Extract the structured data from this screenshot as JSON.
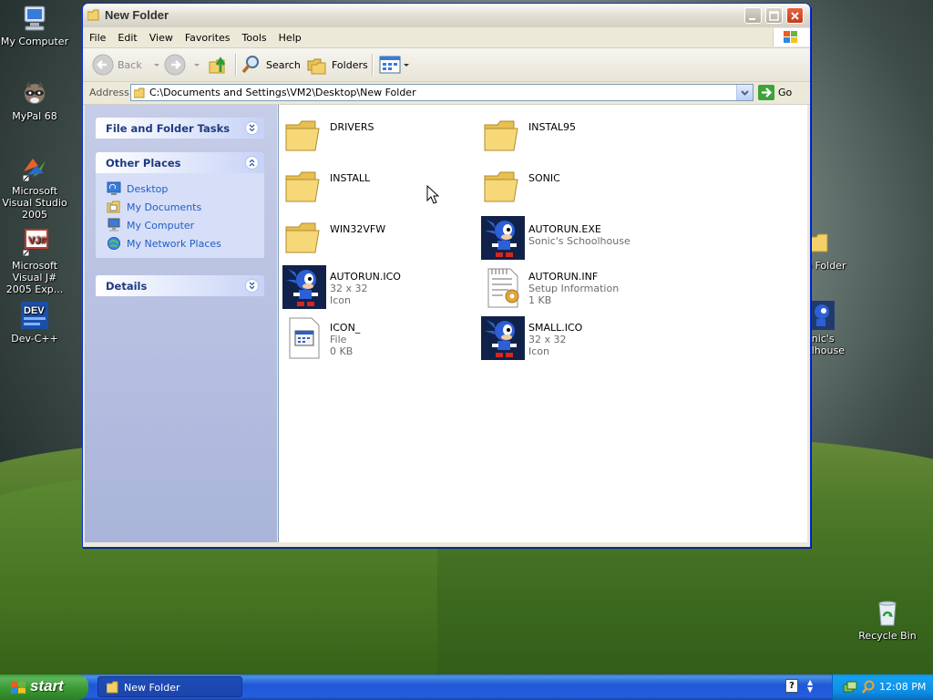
{
  "desktop": {
    "icons": [
      {
        "label": "My Computer"
      },
      {
        "label": "MyPal 68"
      },
      {
        "label": "Microsoft Visual Studio 2005"
      },
      {
        "label": "Microsoft Visual J# 2005 Exp..."
      },
      {
        "label": "Dev-C++"
      },
      {
        "label": "p Folder"
      },
      {
        "label": "onic's olhouse"
      },
      {
        "label": "Recycle Bin"
      }
    ]
  },
  "window": {
    "title": "New Folder",
    "menu": [
      "File",
      "Edit",
      "View",
      "Favorites",
      "Tools",
      "Help"
    ],
    "toolbar": {
      "back_label": "Back",
      "search_label": "Search",
      "folders_label": "Folders"
    },
    "address": {
      "label": "Address",
      "path": "C:\\Documents and Settings\\VM2\\Desktop\\New Folder",
      "go_label": "Go"
    },
    "taskpane": {
      "file_tasks": "File and Folder Tasks",
      "other_places": "Other Places",
      "places": [
        "Desktop",
        "My Documents",
        "My Computer",
        "My Network Places"
      ],
      "details": "Details"
    },
    "files": [
      {
        "name": "DRIVERS",
        "line2": "",
        "line3": "",
        "icon": "folder-icon"
      },
      {
        "name": "INSTAL95",
        "line2": "",
        "line3": "",
        "icon": "folder-icon"
      },
      {
        "name": "INSTALL",
        "line2": "",
        "line3": "",
        "icon": "folder-icon"
      },
      {
        "name": "SONIC",
        "line2": "",
        "line3": "",
        "icon": "folder-icon"
      },
      {
        "name": "WIN32VFW",
        "line2": "",
        "line3": "",
        "icon": "folder-icon"
      },
      {
        "name": "AUTORUN.EXE",
        "line2": "Sonic's Schoolhouse",
        "line3": "",
        "icon": "sonic-icon"
      },
      {
        "name": "AUTORUN.ICO",
        "line2": "32 x 32",
        "line3": "Icon",
        "icon": "sonic-icon"
      },
      {
        "name": "AUTORUN.INF",
        "line2": "Setup Information",
        "line3": "1 KB",
        "icon": "setup-info-icon"
      },
      {
        "name": "ICON_",
        "line2": "File",
        "line3": "0 KB",
        "icon": "generic-file-icon"
      },
      {
        "name": "SMALL.ICO",
        "line2": "32 x 32",
        "line3": "Icon",
        "icon": "sonic-icon"
      }
    ]
  },
  "taskbar": {
    "start_label": "start",
    "task_label": "New Folder",
    "clock": "12:08 PM"
  }
}
